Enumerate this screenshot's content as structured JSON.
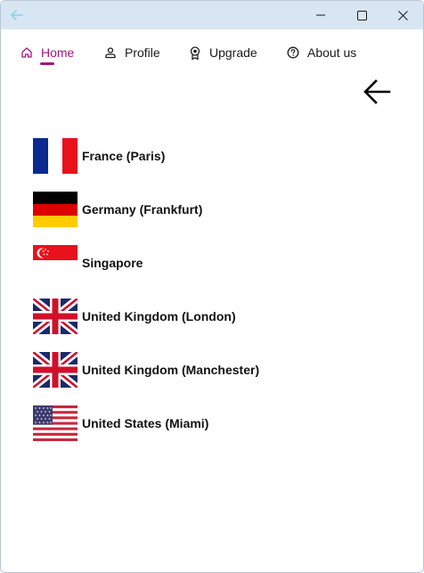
{
  "titlebar": {
    "back_icon": "arrow-left-icon",
    "minimize_icon": "minimize-icon",
    "maximize_icon": "maximize-icon",
    "close_icon": "close-icon"
  },
  "nav": {
    "items": [
      {
        "label": "Home",
        "icon": "home-icon",
        "active": true
      },
      {
        "label": "Profile",
        "icon": "person-icon",
        "active": false
      },
      {
        "label": "Upgrade",
        "icon": "badge-icon",
        "active": false
      },
      {
        "label": "About us",
        "icon": "question-icon",
        "active": false
      }
    ],
    "accent_color": "#a3157f"
  },
  "content": {
    "back_icon": "arrow-left-icon"
  },
  "locations": [
    {
      "label": "France (Paris)",
      "flag": "flag-france"
    },
    {
      "label": "Germany (Frankfurt)",
      "flag": "flag-germany"
    },
    {
      "label": "Singapore",
      "flag": "flag-singapore"
    },
    {
      "label": "United Kingdom (London)",
      "flag": "flag-uk"
    },
    {
      "label": "United Kingdom (Manchester)",
      "flag": "flag-uk"
    },
    {
      "label": "United States (Miami)",
      "flag": "flag-usa"
    }
  ]
}
